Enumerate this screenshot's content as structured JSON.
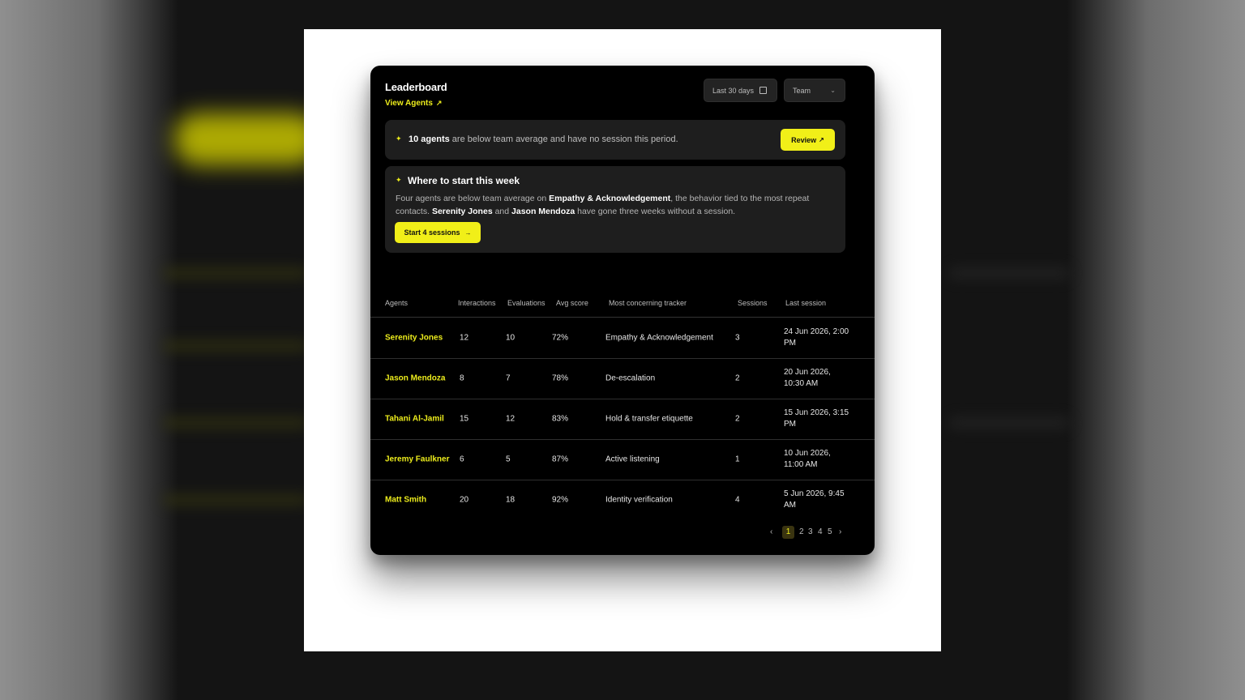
{
  "header": {
    "title": "Leaderboard",
    "view_link": "View Agents",
    "date_filter": "Last 30 days",
    "scope_filter": "Team"
  },
  "alert": {
    "highlight": "10 agents",
    "text": " are below team average and have no session this period.",
    "button": "Review"
  },
  "insight": {
    "title": "Where to start this week",
    "body_1": "Four agents are below team average on ",
    "behavior": "Empathy & Acknowledgement",
    "body_2": ", the behavior tied to the most repeat contacts. ",
    "agent_a": "Serenity Jones",
    "body_3": " and ",
    "agent_b": "Jason Mendoza",
    "body_4": " have gone three weeks without a session.",
    "button": "Start 4 sessions"
  },
  "table": {
    "columns": [
      "Agents",
      "Interactions",
      "Evaluations",
      "Avg score",
      "Most concerning tracker",
      "Sessions",
      "Last session"
    ],
    "rows": [
      {
        "agent": "Serenity Jones",
        "interactions": "12",
        "evaluations": "10",
        "avg_score": "72%",
        "tracker": "Empathy & Acknowledgement",
        "sessions": "3",
        "last_session": "24 Jun 2026, 2:00 PM"
      },
      {
        "agent": "Jason Mendoza",
        "interactions": "8",
        "evaluations": "7",
        "avg_score": "78%",
        "tracker": "De-escalation",
        "sessions": "2",
        "last_session": "20 Jun 2026, 10:30 AM"
      },
      {
        "agent": "Tahani Al-Jamil",
        "interactions": "15",
        "evaluations": "12",
        "avg_score": "83%",
        "tracker": "Hold & transfer etiquette",
        "sessions": "2",
        "last_session": "15 Jun 2026, 3:15 PM"
      },
      {
        "agent": "Jeremy Faulkner",
        "interactions": "6",
        "evaluations": "5",
        "avg_score": "87%",
        "tracker": "Active listening",
        "sessions": "1",
        "last_session": "10 Jun 2026, 11:00 AM"
      },
      {
        "agent": "Matt Smith",
        "interactions": "20",
        "evaluations": "18",
        "avg_score": "92%",
        "tracker": "Identity verification",
        "sessions": "4",
        "last_session": "5 Jun 2026, 9:45 AM"
      }
    ]
  },
  "pagination": {
    "prev": "‹",
    "pages": [
      "1",
      "2",
      "3",
      "4",
      "5"
    ],
    "current": "1",
    "next": "›"
  },
  "icons": {
    "spark": "sparkle-icon",
    "arrow": "arrow-up-right-icon",
    "calendar": "calendar-icon",
    "chevron": "chevron-down-icon"
  },
  "colors": {
    "accent": "#f1ef18",
    "card_bg": "#000000",
    "panel_bg": "#1e1e1e"
  }
}
